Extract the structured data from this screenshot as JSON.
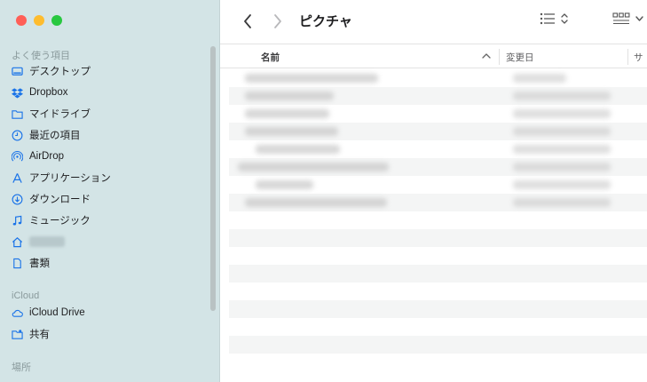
{
  "window": {
    "title": "ピクチャ"
  },
  "sidebar": {
    "sections": [
      {
        "title": "よく使う項目"
      },
      {
        "title": "iCloud"
      },
      {
        "title": "場所"
      }
    ],
    "favorites": [
      {
        "label": "デスクトップ",
        "icon": "desktop-icon"
      },
      {
        "label": "Dropbox",
        "icon": "dropbox-icon"
      },
      {
        "label": "マイドライブ",
        "icon": "folder-icon"
      },
      {
        "label": "最近の項目",
        "icon": "clock-icon"
      },
      {
        "label": "AirDrop",
        "icon": "airdrop-icon"
      },
      {
        "label": "アプリケーション",
        "icon": "applications-icon"
      },
      {
        "label": "ダウンロード",
        "icon": "download-icon"
      },
      {
        "label": "ミュージック",
        "icon": "music-icon"
      },
      {
        "label": "",
        "icon": "home-icon"
      },
      {
        "label": "書類",
        "icon": "document-icon"
      }
    ],
    "icloud": [
      {
        "label": "iCloud Drive",
        "icon": "cloud-icon"
      },
      {
        "label": "共有",
        "icon": "shared-folder-icon"
      }
    ]
  },
  "columns": {
    "name": "名前",
    "date": "変更日",
    "size": "サ"
  },
  "colors": {
    "sidebar_bg": "#d3e4e6",
    "close": "#ff5f57",
    "minimize": "#febc2e",
    "zoom": "#28c840",
    "accent": "#1a73e8"
  }
}
